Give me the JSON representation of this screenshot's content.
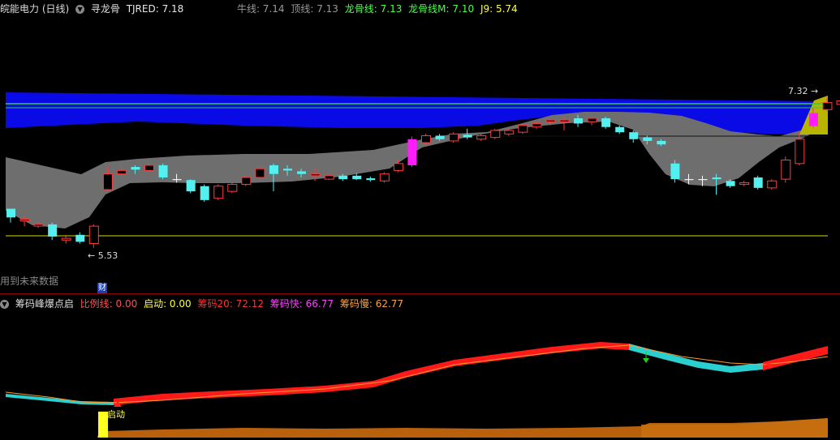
{
  "main": {
    "stock": "皖能电力 (日线)",
    "indicator": "寻龙骨",
    "items": [
      {
        "text": "TJRED: 7.18",
        "color": "#e8e8e8"
      },
      {
        "text": "牛线: 7.14",
        "color": "#9a9a9a"
      },
      {
        "text": "顶线: 7.13",
        "color": "#9a9a9a"
      },
      {
        "text": "龙骨线: 7.13",
        "color": "#4cff4c"
      },
      {
        "text": "龙骨线M: 7.10",
        "color": "#4cff4c"
      },
      {
        "text": "J9: 5.74",
        "color": "#ffff40"
      }
    ],
    "price_high": "7.32",
    "price_low": "5.53",
    "future_note": "用到未来数据",
    "cai_label": "财"
  },
  "sub": {
    "indicator": "筹码峰爆点启",
    "items": [
      {
        "text": "比例线: 0.00",
        "color": "#ff5050"
      },
      {
        "text": "启动: 0.00",
        "color": "#ffff40"
      },
      {
        "text": "筹码20: 72.12",
        "color": "#ff3030"
      },
      {
        "text": "筹码快: 66.77",
        "color": "#ff40ff"
      },
      {
        "text": "筹码慢: 62.77",
        "color": "#ffa040"
      }
    ],
    "start_label": "启动"
  },
  "chart_data": {
    "type": "candlestick",
    "y_range": [
      5.4,
      7.45
    ],
    "candles": [
      [
        6.0,
        5.9,
        5.95,
        5.84
      ],
      [
        5.86,
        5.88,
        5.92,
        5.8
      ],
      [
        5.8,
        5.82,
        5.84,
        5.78
      ],
      [
        5.82,
        5.68,
        5.84,
        5.64
      ],
      [
        5.64,
        5.66,
        5.7,
        5.6
      ],
      [
        5.7,
        5.62,
        5.73,
        5.6
      ],
      [
        5.6,
        5.8,
        5.82,
        5.55
      ],
      [
        6.22,
        6.4,
        6.48,
        6.2
      ],
      [
        6.4,
        6.44,
        6.52,
        6.38
      ],
      [
        6.48,
        6.45,
        6.5,
        6.4
      ],
      [
        6.44,
        6.5,
        6.52,
        6.42
      ],
      [
        6.5,
        6.36,
        6.52,
        6.34
      ],
      [
        6.34,
        6.33,
        6.4,
        6.3
      ],
      [
        6.33,
        6.2,
        6.34,
        6.18
      ],
      [
        6.26,
        6.1,
        6.28,
        6.08
      ],
      [
        6.12,
        6.26,
        6.28,
        6.1
      ],
      [
        6.2,
        6.28,
        6.3,
        6.18
      ],
      [
        6.28,
        6.36,
        6.38,
        6.26
      ],
      [
        6.36,
        6.46,
        6.48,
        6.34
      ],
      [
        6.5,
        6.4,
        6.52,
        6.2
      ],
      [
        6.46,
        6.44,
        6.5,
        6.38
      ],
      [
        6.43,
        6.4,
        6.46,
        6.36
      ],
      [
        6.38,
        6.4,
        6.46,
        6.32
      ],
      [
        6.34,
        6.38,
        6.4,
        6.33
      ],
      [
        6.38,
        6.34,
        6.4,
        6.32
      ],
      [
        6.38,
        6.34,
        6.41,
        6.33
      ],
      [
        6.35,
        6.33,
        6.37,
        6.31
      ],
      [
        6.32,
        6.4,
        6.42,
        6.3
      ],
      [
        6.44,
        6.52,
        6.56,
        6.42
      ],
      [
        6.5,
        6.8,
        6.83,
        6.48
      ],
      [
        6.76,
        6.84,
        6.86,
        6.74
      ],
      [
        6.84,
        6.8,
        6.86,
        6.78
      ],
      [
        6.78,
        6.86,
        6.88,
        6.76
      ],
      [
        6.85,
        6.82,
        6.92,
        6.8
      ],
      [
        6.8,
        6.84,
        6.86,
        6.78
      ],
      [
        6.82,
        6.9,
        6.92,
        6.8
      ],
      [
        6.86,
        6.9,
        6.92,
        6.84
      ],
      [
        6.88,
        6.96,
        6.98,
        6.86
      ],
      [
        6.94,
        6.98,
        7.0,
        6.92
      ],
      [
        7.0,
        7.02,
        7.04,
        6.96
      ],
      [
        7.0,
        7.02,
        7.06,
        6.9
      ],
      [
        7.04,
        6.98,
        7.08,
        6.94
      ],
      [
        7.0,
        7.04,
        7.06,
        6.96
      ],
      [
        7.04,
        6.94,
        7.06,
        6.92
      ],
      [
        6.94,
        6.88,
        6.96,
        6.86
      ],
      [
        6.88,
        6.8,
        6.9,
        6.76
      ],
      [
        6.82,
        6.78,
        6.84,
        6.74
      ],
      [
        6.78,
        6.74,
        6.8,
        6.72
      ],
      [
        6.52,
        6.34,
        6.56,
        6.3
      ],
      [
        6.34,
        6.33,
        6.4,
        6.28
      ],
      [
        6.34,
        6.33,
        6.38,
        6.26
      ],
      [
        6.36,
        6.34,
        6.4,
        6.16
      ],
      [
        6.32,
        6.26,
        6.34,
        6.24
      ],
      [
        6.28,
        6.3,
        6.32,
        6.26
      ],
      [
        6.36,
        6.24,
        6.38,
        6.22
      ],
      [
        6.24,
        6.32,
        6.34,
        6.22
      ],
      [
        6.34,
        6.56,
        6.6,
        6.3
      ],
      [
        6.52,
        6.8,
        6.88,
        6.5
      ],
      [
        6.95,
        7.1,
        7.16,
        6.93
      ],
      [
        7.14,
        7.22,
        7.28,
        7.12
      ],
      [
        7.2,
        7.24,
        7.32,
        7.18
      ],
      [
        7.24,
        7.3,
        7.32,
        7.22
      ],
      [
        7.28,
        7.3,
        7.32,
        7.26
      ]
    ],
    "magenta_candle_indices": [
      29,
      58
    ],
    "support_line": 5.72,
    "keel_line": 6.88,
    "sub_panel": {
      "series": [
        "比例线",
        "启动",
        "筹码20",
        "筹码快",
        "筹码慢"
      ]
    }
  }
}
